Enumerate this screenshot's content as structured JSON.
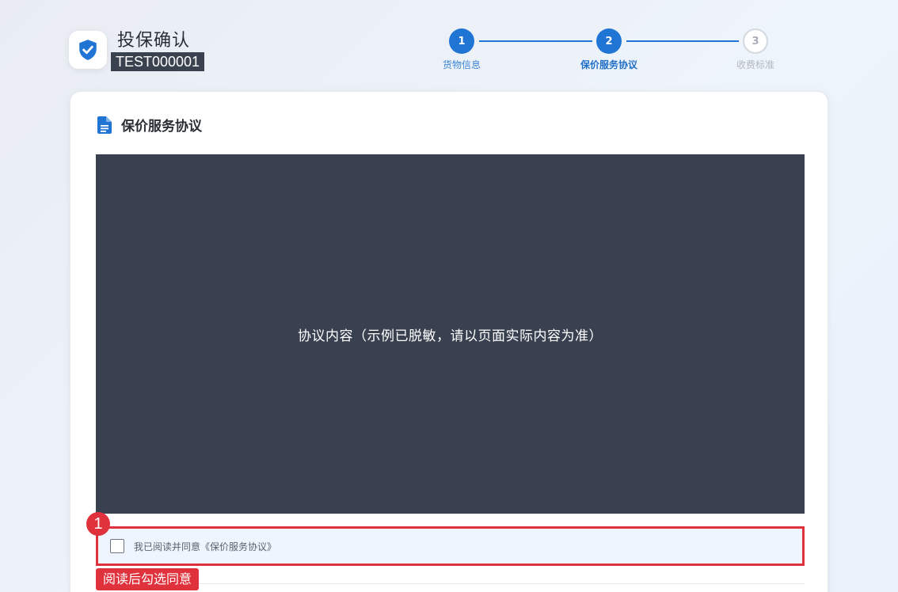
{
  "header": {
    "title": "投保确认",
    "order_no": "TEST000001",
    "logo_icon": "shield-check-icon"
  },
  "stepper": {
    "steps": [
      {
        "number": "1",
        "label": "货物信息",
        "state": "completed"
      },
      {
        "number": "2",
        "label": "保价服务协议",
        "state": "current"
      },
      {
        "number": "3",
        "label": "收费标准",
        "state": "pending"
      }
    ]
  },
  "card": {
    "section_title": "保价服务协议",
    "section_icon": "document-icon",
    "agreement_content": "协议内容（示例已脱敏，请以页面实际内容为准）",
    "agree_label": "我已阅读并同意《保价服务协议》",
    "agree_checked": false
  },
  "annotation": {
    "badge": "1",
    "tip": "阅读后勾选同意"
  },
  "colors": {
    "accent": "#1f74d4",
    "annotation": "#e0323d",
    "agreement_bg": "#394150"
  }
}
